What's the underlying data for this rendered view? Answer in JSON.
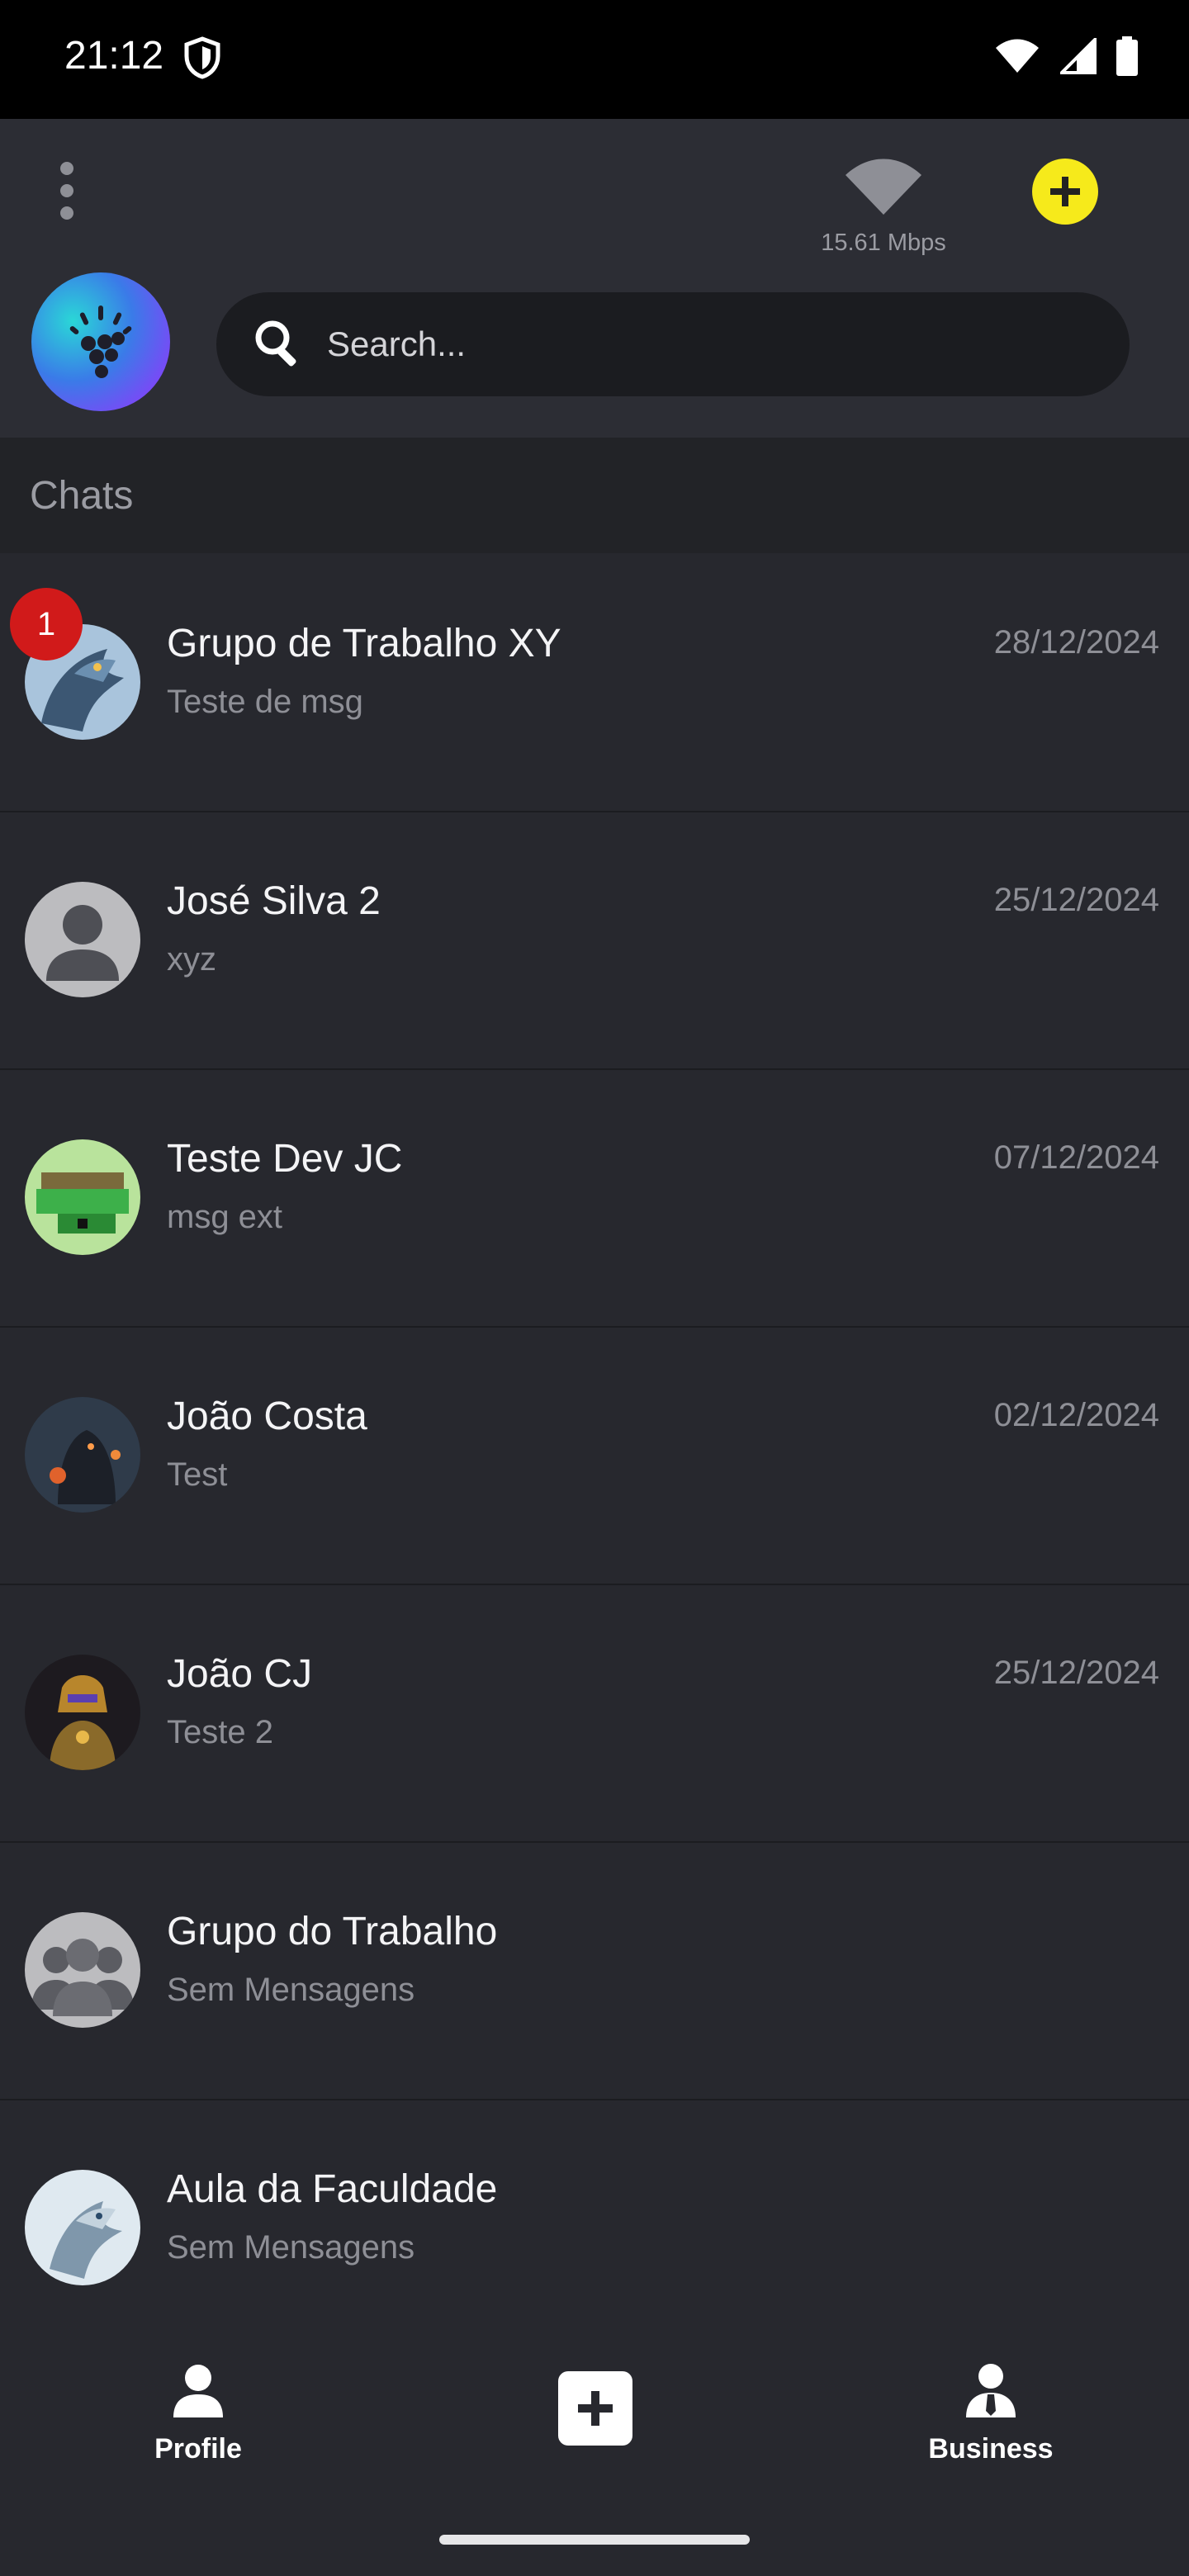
{
  "status_bar": {
    "time": "21:12"
  },
  "header": {
    "network_speed": "15.61 Mbps",
    "search_placeholder": "Search..."
  },
  "section": {
    "title": "Chats"
  },
  "chats": [
    {
      "name": "Grupo de Trabalho XY",
      "message": "Teste de msg",
      "date": "28/12/2024",
      "badge": "1",
      "avatar": "dragon"
    },
    {
      "name": "José Silva 2",
      "message": "xyz",
      "date": "25/12/2024",
      "badge": "",
      "avatar": "default-person"
    },
    {
      "name": "Teste Dev JC",
      "message": "msg ext",
      "date": "07/12/2024",
      "badge": "",
      "avatar": "pixel-turtle"
    },
    {
      "name": "João Costa",
      "message": "Test",
      "date": "02/12/2024",
      "badge": "",
      "avatar": "dark-knight"
    },
    {
      "name": "João CJ",
      "message": "Teste 2",
      "date": "25/12/2024",
      "badge": "",
      "avatar": "armored-hero"
    },
    {
      "name": "Grupo do Trabalho",
      "message": "Sem Mensagens",
      "date": "",
      "badge": "",
      "avatar": "default-group"
    },
    {
      "name": "Aula da Faculdade",
      "message": "Sem Mensagens",
      "date": "",
      "badge": "",
      "avatar": "dragon-white"
    }
  ],
  "bottom_nav": {
    "profile_label": "Profile",
    "business_label": "Business"
  },
  "colors": {
    "background": "#27282e",
    "accent_yellow": "#f6ea1b",
    "badge_red": "#d11a1a"
  }
}
